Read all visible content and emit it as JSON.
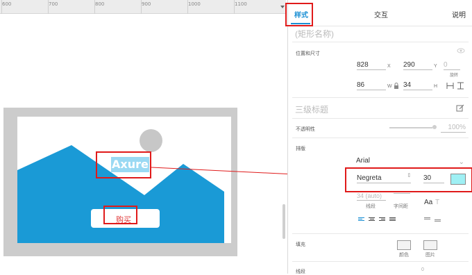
{
  "ruler": {
    "ticks": [
      "600",
      "700",
      "800",
      "900",
      "1000",
      "1100"
    ]
  },
  "widget": {
    "title_text": "Axure",
    "button_label": "购买"
  },
  "panel": {
    "tabs": [
      {
        "label": "样式"
      },
      {
        "label": "交互"
      },
      {
        "label": "说明"
      }
    ],
    "shape_name": "(矩形名称)",
    "position_size": {
      "label": "位置和尺寸",
      "x": "828",
      "x_label": "X",
      "y": "290",
      "y_label": "Y",
      "rotation": "0",
      "rotation_label": "旋转",
      "w": "86",
      "w_label": "W",
      "h": "34",
      "h_label": "H"
    },
    "style_name": "三级标题",
    "opacity": {
      "label": "不透明性",
      "value": "100%"
    },
    "typography": {
      "label": "排版",
      "font_family": "Arial",
      "font_weight": "Negreta",
      "font_size": "30",
      "line_spacing_value": "34 (auto)",
      "line_spacing_label": "线段",
      "char_spacing_label": "字间距",
      "aa_glyph": "Aa",
      "text_color": "#9ff0f4"
    },
    "fill": {
      "label": "填充",
      "color_label": "颜色",
      "image_label": "图片"
    },
    "border": {
      "label": "线段",
      "value": "0"
    }
  },
  "colors": {
    "accent": "#1a8fd4",
    "highlight": "#e01a1a",
    "mountain": "#1a9ad6"
  }
}
